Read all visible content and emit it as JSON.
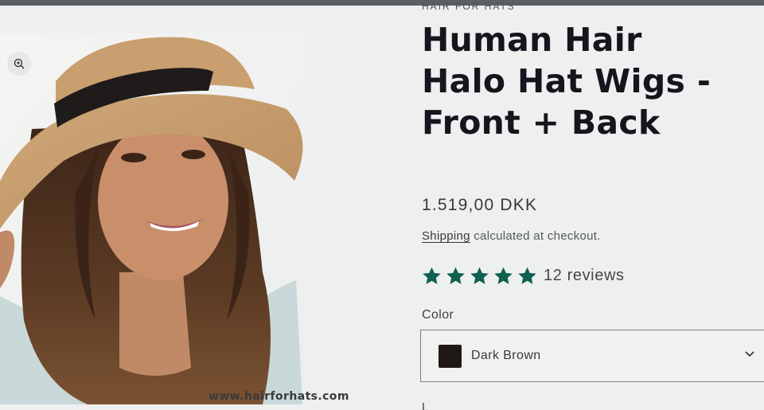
{
  "gallery": {
    "watermark": "www.hairforhats.com",
    "zoom_icon": "magnifier-plus-icon"
  },
  "product": {
    "vendor": "HAIR FOR HATS",
    "title_lines": [
      "Human Hair",
      "Halo Hat Wigs -",
      "Front + Back"
    ],
    "price": "1.519,00 DKK",
    "shipping_link": "Shipping",
    "shipping_text": " calculated at checkout.",
    "rating": {
      "value": 5,
      "max": 5,
      "reviews_label": "12 reviews",
      "star_color": "#10614f"
    },
    "color_label": "Color",
    "color_selected": "Dark Brown",
    "swatch_color": "#1f1814",
    "next_option_label": "L"
  }
}
